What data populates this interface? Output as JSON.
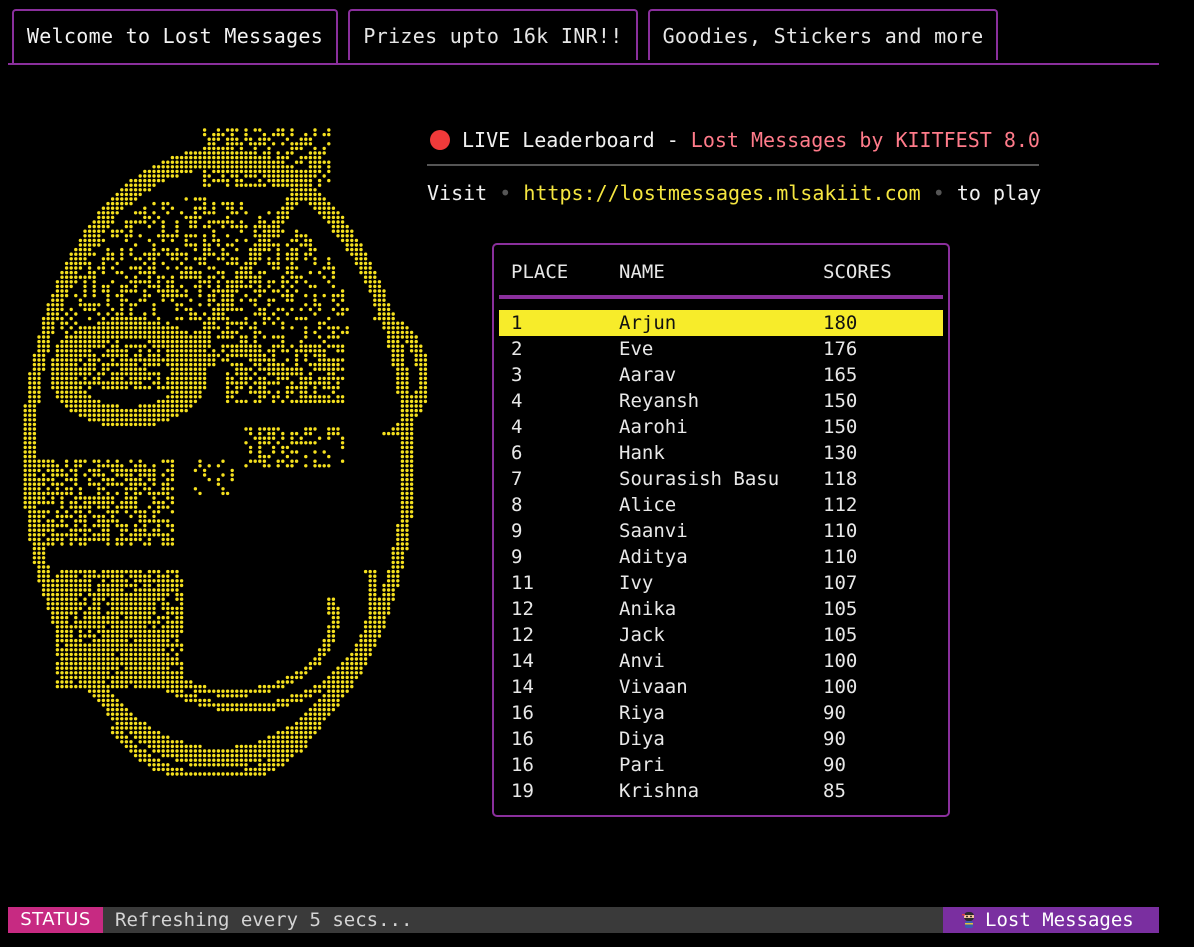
{
  "tabs": [
    {
      "label": "Welcome to Lost Messages",
      "active": true
    },
    {
      "label": "Prizes upto 16k INR!!",
      "active": false
    },
    {
      "label": "Goodies, Stickers and more",
      "active": false
    }
  ],
  "header": {
    "live_label": "LIVE Leaderboard",
    "dash": " - ",
    "event_name": "Lost Messages by KIITFEST 8.0",
    "visit_word": "Visit",
    "bullet": " • ",
    "url": "https://lostmessages.mlsakiit.com",
    "to_play": "to play"
  },
  "leaderboard": {
    "columns": [
      "PLACE",
      "NAME",
      "SCORES"
    ],
    "rows": [
      {
        "place": "1",
        "name": "Arjun",
        "score": "180",
        "selected": true
      },
      {
        "place": "2",
        "name": "Eve",
        "score": "176"
      },
      {
        "place": "3",
        "name": "Aarav",
        "score": "165"
      },
      {
        "place": "4",
        "name": "Reyansh",
        "score": "150"
      },
      {
        "place": "4",
        "name": "Aarohi",
        "score": "150"
      },
      {
        "place": "6",
        "name": "Hank",
        "score": "130"
      },
      {
        "place": "7",
        "name": "Sourasish Basu",
        "score": "118"
      },
      {
        "place": "8",
        "name": "Alice",
        "score": "112"
      },
      {
        "place": "9",
        "name": "Saanvi",
        "score": "110"
      },
      {
        "place": "9",
        "name": "Aditya",
        "score": "110"
      },
      {
        "place": "11",
        "name": "Ivy",
        "score": "107"
      },
      {
        "place": "12",
        "name": "Anika",
        "score": "105"
      },
      {
        "place": "12",
        "name": "Jack",
        "score": "105"
      },
      {
        "place": "14",
        "name": "Anvi",
        "score": "100"
      },
      {
        "place": "14",
        "name": "Vivaan",
        "score": "100"
      },
      {
        "place": "16",
        "name": "Riya",
        "score": "90"
      },
      {
        "place": "16",
        "name": "Diya",
        "score": "90"
      },
      {
        "place": "16",
        "name": "Pari",
        "score": "90"
      },
      {
        "place": "19",
        "name": "Krishna",
        "score": "85"
      }
    ]
  },
  "status": {
    "tag": "STATUS",
    "message": "Refreshing every 5 secs...",
    "app_name": "Lost Messages",
    "app_icon": "ninja-icon"
  },
  "colors": {
    "accent_purple": "#8a2f9c",
    "highlight_yellow": "#f7ec2a",
    "live_red": "#f03a3a",
    "event_pink": "#ff7b8a",
    "url_yellow": "#f5e640",
    "status_pink": "#c72a82",
    "status_purple": "#7a2fa0",
    "art_yellow": "#f5e01e"
  },
  "art": {
    "icon": "braille-face-art"
  }
}
